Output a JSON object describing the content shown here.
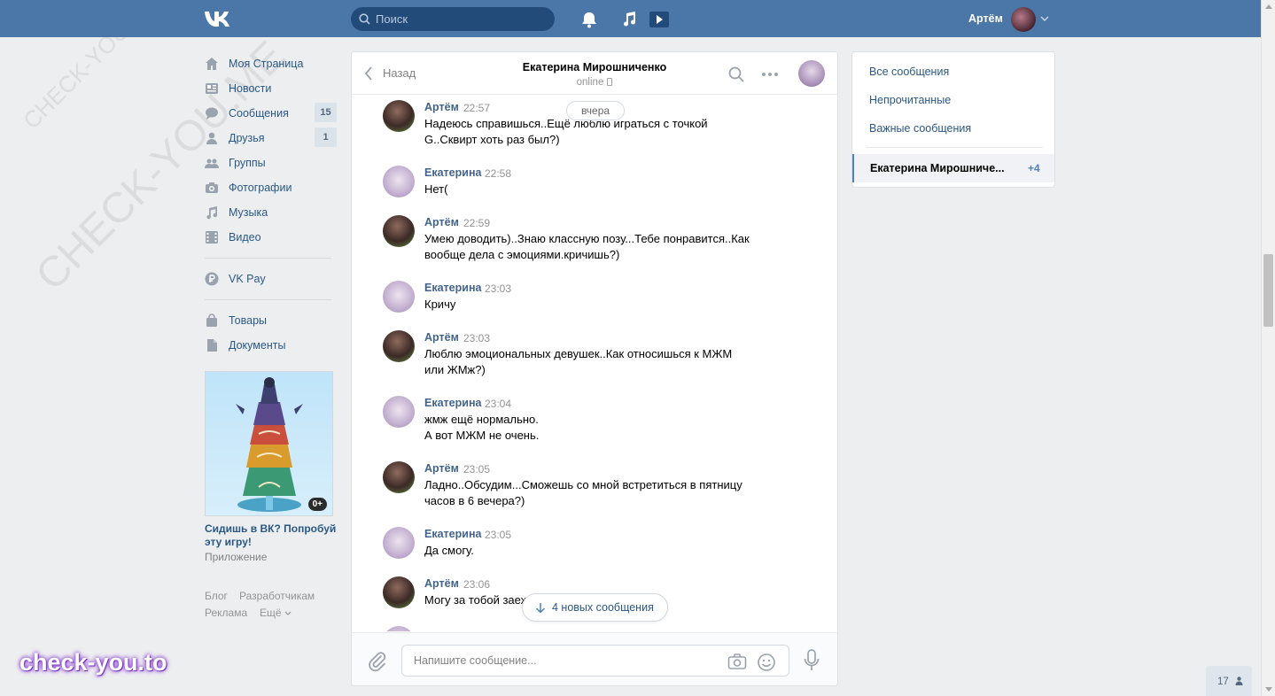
{
  "header": {
    "search_placeholder": "Поиск",
    "user_name": "Артём",
    "icons": [
      "bell-icon",
      "music-note-icon",
      "video-play-icon"
    ],
    "brand_color": "#4a76a8"
  },
  "nav": {
    "items": [
      {
        "label": "Моя Страница",
        "icon": "home-icon",
        "count": ""
      },
      {
        "label": "Новости",
        "icon": "news-icon",
        "count": ""
      },
      {
        "label": "Сообщения",
        "icon": "messages-icon",
        "count": "15"
      },
      {
        "label": "Друзья",
        "icon": "friends-icon",
        "count": "1"
      },
      {
        "label": "Группы",
        "icon": "groups-icon",
        "count": ""
      },
      {
        "label": "Фотографии",
        "icon": "camera-icon",
        "count": ""
      },
      {
        "label": "Музыка",
        "icon": "music-icon",
        "count": ""
      },
      {
        "label": "Видео",
        "icon": "film-icon",
        "count": ""
      },
      {
        "label": "VK Pay",
        "icon": "ruble-icon",
        "count": ""
      },
      {
        "label": "Товары",
        "icon": "bag-icon",
        "count": ""
      },
      {
        "label": "Документы",
        "icon": "document-icon",
        "count": ""
      }
    ]
  },
  "ad": {
    "badge": "0+",
    "title": "Сидишь в ВК? Попробуй эту игру!",
    "subtitle": "Приложение"
  },
  "footer": {
    "links": [
      "Блог",
      "Разработчикам",
      "Реклама",
      "Ещё"
    ]
  },
  "chat": {
    "back_label": "Назад",
    "peer_name": "Екатерина Мирошниченко",
    "peer_status": "online",
    "day_label": "вчера",
    "new_messages_label": "4 новых сообщения",
    "input_placeholder": "Напишите сообщение...",
    "messages": [
      {
        "author": "Артём",
        "time": "22:57",
        "text": "Надеюсь справишься..Ещё люблю играться с точкой G..Сквирт хоть раз был?)",
        "who": "a"
      },
      {
        "author": "Екатерина",
        "time": "22:58",
        "text": "Нет(",
        "who": "k"
      },
      {
        "author": "Артём",
        "time": "22:59",
        "text": "Умею доводить)..Знаю классную позу...Тебе понравится..Как вообще дела с эмоциями.кричишь?)",
        "who": "a"
      },
      {
        "author": "Екатерина",
        "time": "23:03",
        "text": "Кричу",
        "who": "k"
      },
      {
        "author": "Артём",
        "time": "23:03",
        "text": "Люблю эмоциональных девушек..Как относишься к МЖМ или ЖМж?)",
        "who": "a"
      },
      {
        "author": "Екатерина",
        "time": "23:04",
        "text": "жмж ещё нормально.\nА вот МЖМ не очень.",
        "who": "k"
      },
      {
        "author": "Артём",
        "time": "23:05",
        "text": "Ладно..Обсудим...Сможешь со мной встретиться в пятницу часов в 6 вечера?)",
        "who": "a"
      },
      {
        "author": "Екатерина",
        "time": "23:05",
        "text": "Да смогу.",
        "who": "k"
      },
      {
        "author": "Артём",
        "time": "23:06",
        "text": "Могу за тобой заех",
        "who": "a"
      }
    ]
  },
  "filters": {
    "items": [
      "Все сообщения",
      "Непрочитанные",
      "Важные сообщения"
    ],
    "conversation_name": "Екатерина Мирошниче...",
    "conversation_count": "+4"
  },
  "online_counter": "17",
  "watermark": {
    "diagonal": "CHECK-YOU.ME",
    "brand": "check-you.to"
  }
}
